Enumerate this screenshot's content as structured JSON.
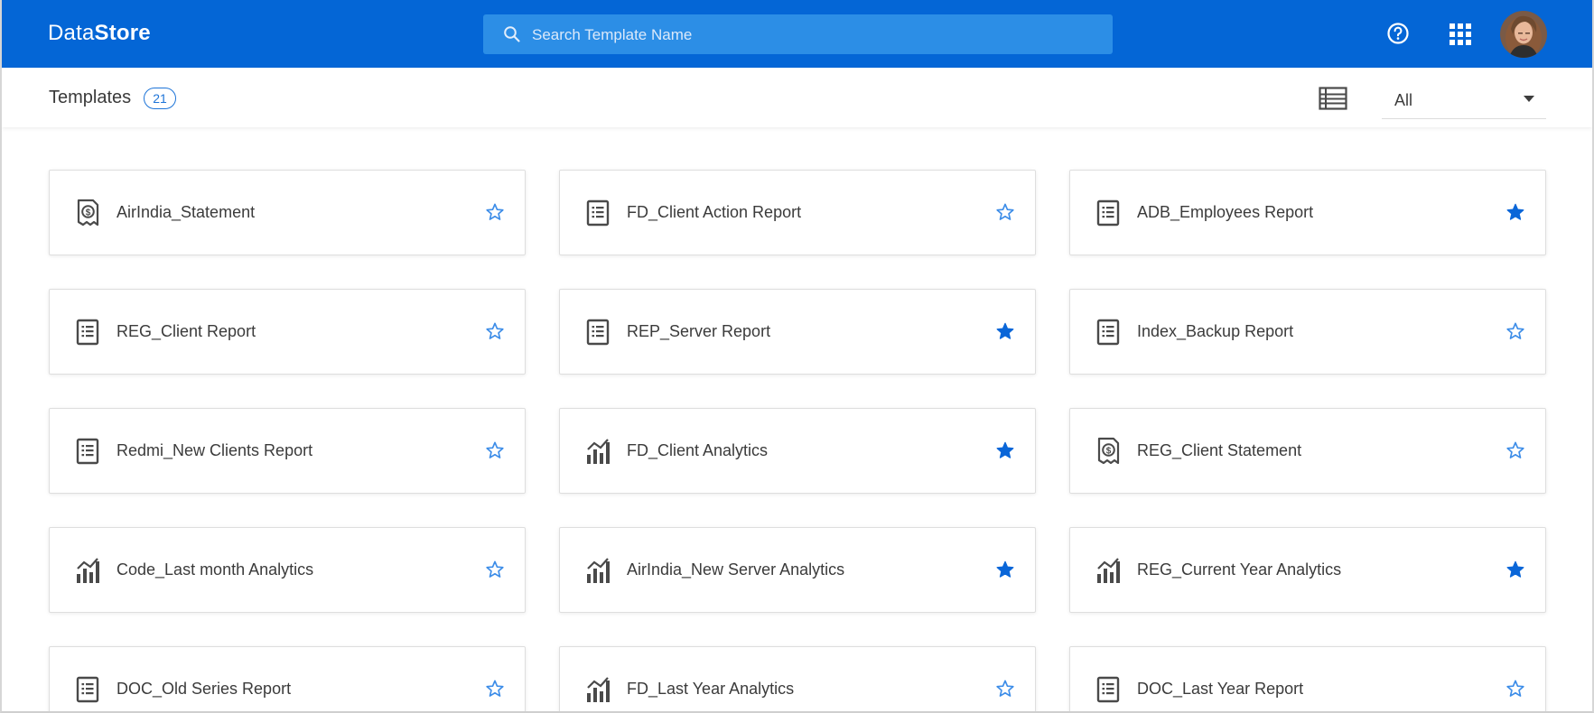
{
  "app": {
    "brand_part1": "Data",
    "brand_part2": "Store"
  },
  "search": {
    "placeholder": "Search Template Name"
  },
  "header_icons": [
    "help-icon",
    "apps-grid-icon",
    "avatar"
  ],
  "subheader": {
    "title": "Templates",
    "count": "21",
    "filter_value": "All"
  },
  "colors": {
    "primary": "#0466d6",
    "star_filled": "#0a66d8",
    "star_outline": "#3d8de8",
    "icon_gray": "#4a4a4a"
  },
  "templates": [
    {
      "name": "AirIndia_Statement",
      "icon": "statement-icon",
      "favorite": false
    },
    {
      "name": "FD_Client Action Report",
      "icon": "report-icon",
      "favorite": false
    },
    {
      "name": "ADB_Employees Report",
      "icon": "report-icon",
      "favorite": true
    },
    {
      "name": "REG_Client Report",
      "icon": "report-icon",
      "favorite": false
    },
    {
      "name": "REP_Server Report",
      "icon": "report-icon",
      "favorite": true
    },
    {
      "name": "Index_Backup Report",
      "icon": "report-icon",
      "favorite": false
    },
    {
      "name": "Redmi_New Clients Report",
      "icon": "report-icon",
      "favorite": false
    },
    {
      "name": "FD_Client Analytics",
      "icon": "analytics-icon",
      "favorite": true
    },
    {
      "name": "REG_Client Statement",
      "icon": "statement-icon",
      "favorite": false
    },
    {
      "name": "Code_Last month Analytics",
      "icon": "analytics-icon",
      "favorite": false
    },
    {
      "name": "AirIndia_New Server Analytics",
      "icon": "analytics-icon",
      "favorite": true
    },
    {
      "name": "REG_Current Year Analytics",
      "icon": "analytics-icon",
      "favorite": true
    },
    {
      "name": "DOC_Old Series Report",
      "icon": "report-icon",
      "favorite": false
    },
    {
      "name": "FD_Last Year Analytics",
      "icon": "analytics-icon",
      "favorite": false
    },
    {
      "name": "DOC_Last Year Report",
      "icon": "report-icon",
      "favorite": false
    }
  ]
}
